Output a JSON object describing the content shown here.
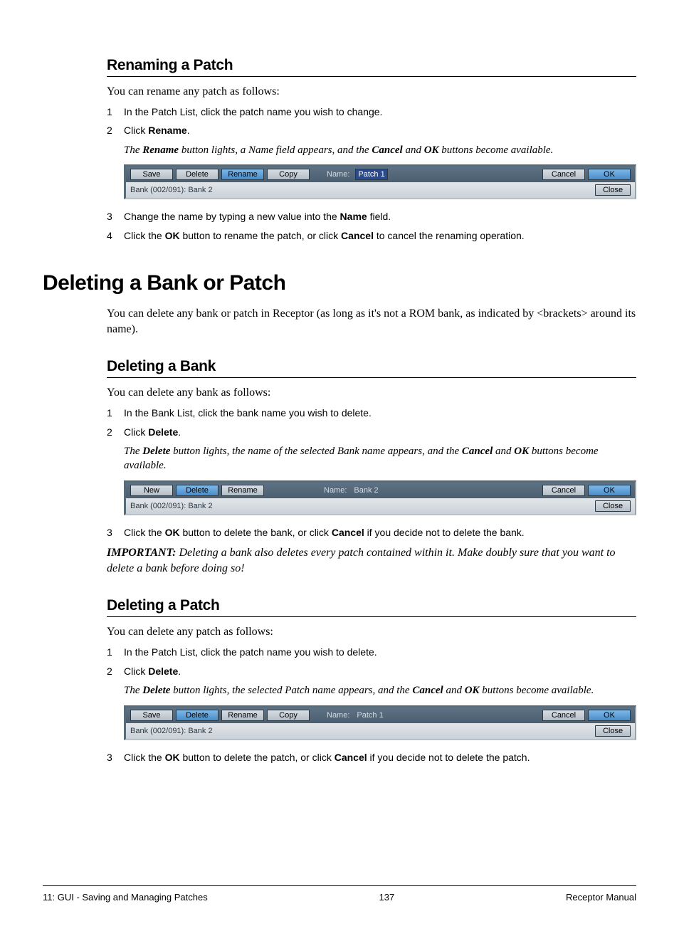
{
  "sec1": {
    "title": "Renaming a Patch",
    "intro": "You can rename any patch as follows:",
    "step1": "In the Patch List, click the patch name you wish to change.",
    "step2a": "Click ",
    "step2b": "Rename",
    "step2c": ".",
    "note_a": "The ",
    "note_b": "Rename",
    "note_c": " button lights, a Name field appears, and the ",
    "note_d": "Cancel",
    "note_e": " and ",
    "note_f": "OK",
    "note_g": " buttons become available.",
    "step3a": "Change the name by typing a new value into the ",
    "step3b": "Name",
    "step3c": " field.",
    "step4a": "Click the ",
    "step4b": "OK",
    "step4c": " button to rename the patch, or click ",
    "step4d": "Cancel",
    "step4e": " to cancel the renaming operation."
  },
  "tb1": {
    "save": "Save",
    "delete": "Delete",
    "rename": "Rename",
    "copy": "Copy",
    "name_lbl": "Name:",
    "name_val": "Patch 1",
    "cancel": "Cancel",
    "ok": "OK",
    "bank": "Bank (002/091): Bank 2",
    "close": "Close"
  },
  "mainhead": "Deleting a Bank or Patch",
  "mainintro": "You can delete any bank or patch in Receptor (as long as it's not a ROM bank, as indicated by <brackets> around its name).",
  "sec2": {
    "title": "Deleting a Bank",
    "intro": "You can delete any bank as follows:",
    "step1": "In the Bank List, click the bank name you wish to delete.",
    "step2a": "Click ",
    "step2b": "Delete",
    "step2c": ".",
    "note_a": "The ",
    "note_b": "Delete",
    "note_c": " button lights, the name of the selected Bank name appears, and the ",
    "note_d": "Cancel",
    "note_e": " and ",
    "note_f": "OK",
    "note_g": " buttons become available.",
    "step3a": "Click the ",
    "step3b": "OK",
    "step3c": " button to delete the bank, or click ",
    "step3d": "Cancel",
    "step3e": " if you decide not to delete the bank."
  },
  "tb2": {
    "new": "New",
    "delete": "Delete",
    "rename": "Rename",
    "name_lbl": "Name:",
    "name_val": "Bank 2",
    "cancel": "Cancel",
    "ok": "OK",
    "bank": "Bank (002/091): Bank 2",
    "close": "Close"
  },
  "imp_a": "IMPORTANT:",
  "imp_b": " Deleting a bank also deletes every patch contained within it. Make doubly sure that you want to delete a bank before doing so!",
  "sec3": {
    "title": "Deleting a Patch",
    "intro": "You can delete any patch as follows:",
    "step1": "In the Patch List, click the patch name you wish to delete.",
    "step2a": "Click ",
    "step2b": "Delete",
    "step2c": ".",
    "note_a": "The ",
    "note_b": "Delete",
    "note_c": " button lights, the selected Patch name appears, and the ",
    "note_d": "Cancel",
    "note_e": " and ",
    "note_f": "OK",
    "note_g": " buttons become available.",
    "step3a": "Click the ",
    "step3b": "OK",
    "step3c": " button to delete the patch, or click ",
    "step3d": "Cancel",
    "step3e": " if you decide not to delete the patch."
  },
  "tb3": {
    "save": "Save",
    "delete": "Delete",
    "rename": "Rename",
    "copy": "Copy",
    "name_lbl": "Name:",
    "name_val": "Patch 1",
    "cancel": "Cancel",
    "ok": "OK",
    "bank": "Bank (002/091): Bank 2",
    "close": "Close"
  },
  "footer": {
    "left": "11: GUI - Saving and Managing Patches",
    "center": "137",
    "right": "Receptor Manual"
  }
}
